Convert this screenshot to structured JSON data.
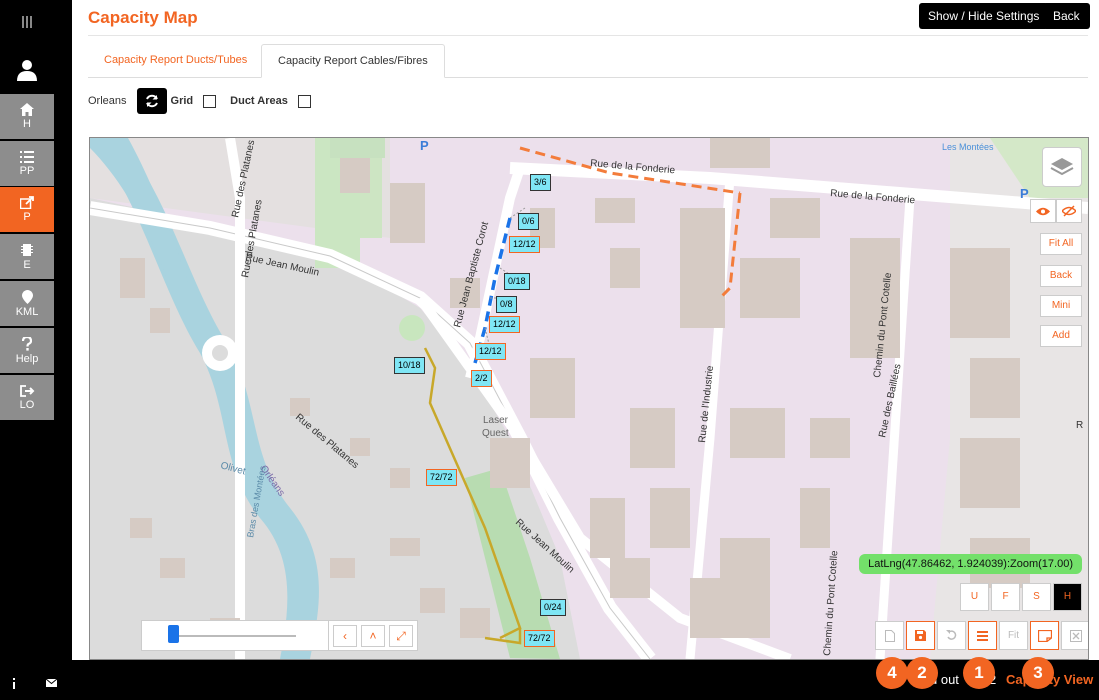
{
  "app": {
    "title": "Capacity Map"
  },
  "header": {
    "settings_btn": "Show / Hide Settings",
    "back_btn": "Back"
  },
  "tabs": [
    {
      "label": "Capacity Report Ducts/Tubes"
    },
    {
      "label": "Capacity Report Cables/Fibres"
    }
  ],
  "options": {
    "area": "Orleans",
    "grid_label": "Grid",
    "duct_label": "Duct Areas"
  },
  "sidebar": {
    "items": [
      {
        "label": "H",
        "icon": "home-icon"
      },
      {
        "label": "PP",
        "icon": "list-icon"
      },
      {
        "label": "P",
        "icon": "share-icon"
      },
      {
        "label": "E",
        "icon": "chip-icon"
      },
      {
        "label": "KML",
        "icon": "map-pin-icon"
      },
      {
        "label": "Help",
        "icon": "question-icon"
      },
      {
        "label": "LO",
        "icon": "logout-icon"
      }
    ]
  },
  "map": {
    "streets": {
      "fonderie1": "Rue de la Fonderie",
      "fonderie2": "Rue de la Fonderie",
      "platanes1": "Rue des Platanes",
      "platanes2": "Rue des Platanes",
      "platanes3": "Rue des Platanes",
      "moulin1": "Rue Jean Moulin",
      "moulin2": "Rue Jean Moulin",
      "corot": "Rue Jean Baptiste Corot",
      "industrie": "Rue de l'Industrie",
      "cotelle1": "Chemin du Pont Cotelle",
      "cotelle2": "Chemin du Pont Cotelle",
      "baillees": "Rue des Baillées",
      "montees": "Les Montées",
      "quest1": "Laser",
      "quest2": "Quest",
      "olivet": "Olivet",
      "orleans": "Orléans",
      "bras": "Bras des Montées",
      "truncated_r": "R"
    },
    "labels": [
      "3/6",
      "0/6",
      "12/12",
      "0/18",
      "0/8",
      "12/12",
      "12/12",
      "2/2",
      "10/18",
      "72/72",
      "0/24",
      "72/72"
    ],
    "latlng": "LatLng(47.86462, 1.924039):Zoom(17.00)",
    "side_buttons": {
      "fit_all": "Fit All",
      "back": "Back",
      "mini": "Mini",
      "add": "Add"
    },
    "view_buttons": [
      "U",
      "F",
      "S",
      "H"
    ],
    "fit_label": "Fit"
  },
  "footer": {
    "partial_text": "d out",
    "num": "2",
    "view_label": "Capacity View"
  },
  "callouts": [
    "4",
    "2",
    "1",
    "3"
  ],
  "colors": {
    "accent": "#f26522",
    "cable": "#c8a82a",
    "blue_duct": "#1a73e8"
  }
}
